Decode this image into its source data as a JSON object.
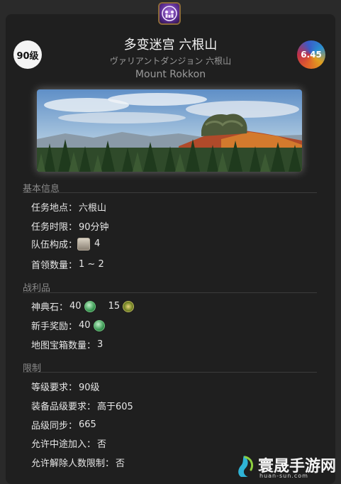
{
  "duty": {
    "level": "90级",
    "patch": "6.45",
    "name_cn": "多变迷宫 六根山",
    "name_jp": "ヴァリアントダンジョン 六根山",
    "name_en": "Mount Rokkon"
  },
  "sections": {
    "basic": {
      "title": "基本信息",
      "location_label": "任务地点：",
      "location_value": "六根山",
      "time_label": "任务时限：",
      "time_value": "90分钟",
      "party_label": "队伍构成：",
      "party_value": "4",
      "boss_label": "首领数量：",
      "boss_value": "1 ~ 2"
    },
    "loot": {
      "title": "战利品",
      "tome_label": "神典石：",
      "tome_value": "40",
      "tome2_value": "15",
      "novice_label": "新手奖励：",
      "novice_value": "40",
      "chest_label": "地图宝箱数量：",
      "chest_value": "3"
    },
    "limits": {
      "title": "限制",
      "level_label": "等级要求：",
      "level_value": "90级",
      "ilvl_label": "装备品级要求：",
      "ilvl_value": "高于605",
      "sync_label": "品级同步：",
      "sync_value": "665",
      "join_label": "允许中途加入：",
      "join_value": "否",
      "unrestricted_label": "允许解除人数限制：",
      "unrestricted_value": "否"
    }
  },
  "watermark": {
    "brand": "寰晟手游网",
    "url": "huan-sun.com"
  },
  "icons": {
    "duty": "duty-roulette-icon",
    "job": "job-icon",
    "tome": "tomestone-icon",
    "tome2": "tomestone-gear-icon"
  }
}
